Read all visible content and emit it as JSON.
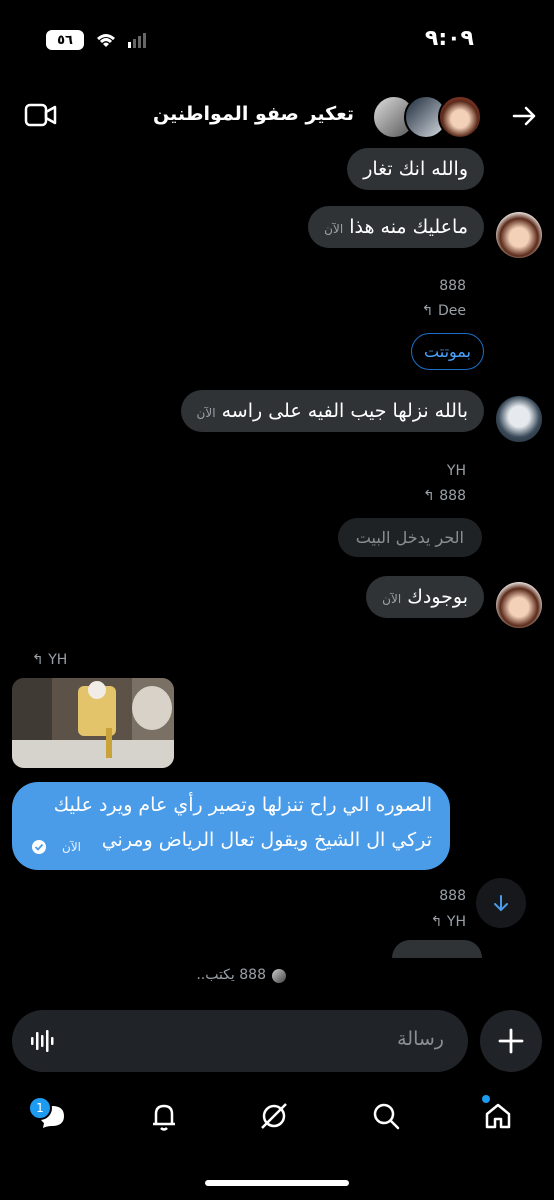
{
  "status_bar": {
    "time": "٩:٠٩",
    "battery": "٥٦"
  },
  "header": {
    "title": "تعكير صفو المواطنين"
  },
  "messages": {
    "m1": {
      "text": "والله انك تغار"
    },
    "m2": {
      "text": "ماعليك منه هذا",
      "time": "الآن"
    },
    "m3": {
      "sender": "888",
      "reply_to": "Dee"
    },
    "m4": {
      "text": "بموتتت"
    },
    "m5": {
      "text": "بالله نزلها جيب الفيه على راسه",
      "time": "الآن"
    },
    "m6": {
      "sender": "YH",
      "reply_to": "888"
    },
    "m7": {
      "text": "الحر يدخل البيت"
    },
    "m8": {
      "text": "بوجودك",
      "time": "الآن"
    },
    "m9": {
      "reply_to": "YH"
    },
    "m10": {
      "line1": "الصوره الي راح تنزلها وتصير رأي عام ويرد عليك",
      "line2": "تركي ال الشيخ ويقول تعال الرياض ومرني",
      "time": "الآن"
    },
    "m11": {
      "sender": "888",
      "reply_to": "YH"
    }
  },
  "typing": "888 يكتب..",
  "composer": {
    "placeholder": "رسالة"
  },
  "nav": {
    "badge": "1"
  },
  "colors": {
    "accent": "#4a9ce8",
    "bubble": "#2f3336",
    "background": "#000000"
  }
}
